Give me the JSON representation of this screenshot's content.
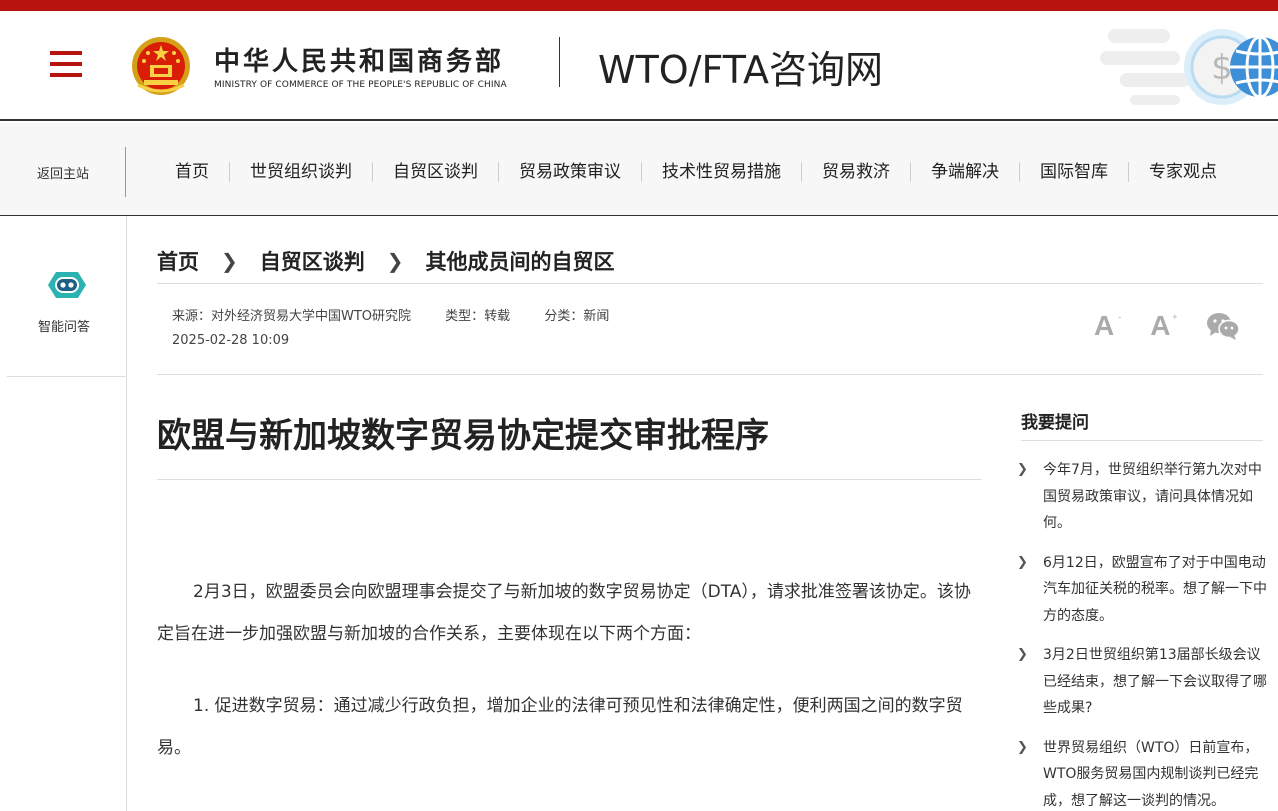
{
  "header": {
    "ministry_cn": "中华人民共和国商务部",
    "ministry_en": "MINISTRY OF COMMERCE OF THE PEOPLE'S REPUBLIC OF CHINA",
    "site_title": "WTO/FTA咨询网"
  },
  "nav": {
    "back_home": "返回主站",
    "items": [
      "首页",
      "世贸组织谈判",
      "自贸区谈判",
      "贸易政策审议",
      "技术性贸易措施",
      "贸易救济",
      "争端解决",
      "国际智库",
      "专家观点"
    ]
  },
  "left": {
    "assistant_label": "智能问答"
  },
  "breadcrumb": [
    "首页",
    "自贸区谈判",
    "其他成员间的自贸区"
  ],
  "meta": {
    "source": "来源：对外经济贸易大学中国WTO研究院",
    "type": "类型：转载",
    "category": "分类：新闻",
    "datetime": "2025-02-28 10:09"
  },
  "tools": {
    "font_smaller": "A",
    "font_smaller_sup": "-",
    "font_larger": "A",
    "font_larger_sup": "+"
  },
  "article": {
    "title": "欧盟与新加坡数字贸易协定提交审批程序",
    "paragraphs": [
      "2月3日，欧盟委员会向欧盟理事会提交了与新加坡的数字贸易协定（DTA），请求批准签署该协定。该协定旨在进一步加强欧盟与新加坡的合作关系，主要体现在以下两个方面：",
      "1. 促进数字贸易：通过减少行政负担，增加企业的法律可预见性和法律确定性，便利两国之间的数字贸易。"
    ]
  },
  "sidebar": {
    "title": "我要提问",
    "questions": [
      "今年7月，世贸组织举行第九次对中国贸易政策审议，请问具体情况如何。",
      "6月12日，欧盟宣布了对于中国电动汽车加征关税的税率。想了解一下中方的态度。",
      "3月2日世贸组织第13届部长级会议已经结束，想了解一下会议取得了哪些成果?",
      "世界贸易组织（WTO）日前宣布，WTO服务贸易国内规制谈判已经完成，想了解这一谈判的情况。"
    ]
  },
  "colors": {
    "brand_red": "#b8140f",
    "accent_teal": "#2bb3b1",
    "globe_blue": "#3d8fd8"
  }
}
